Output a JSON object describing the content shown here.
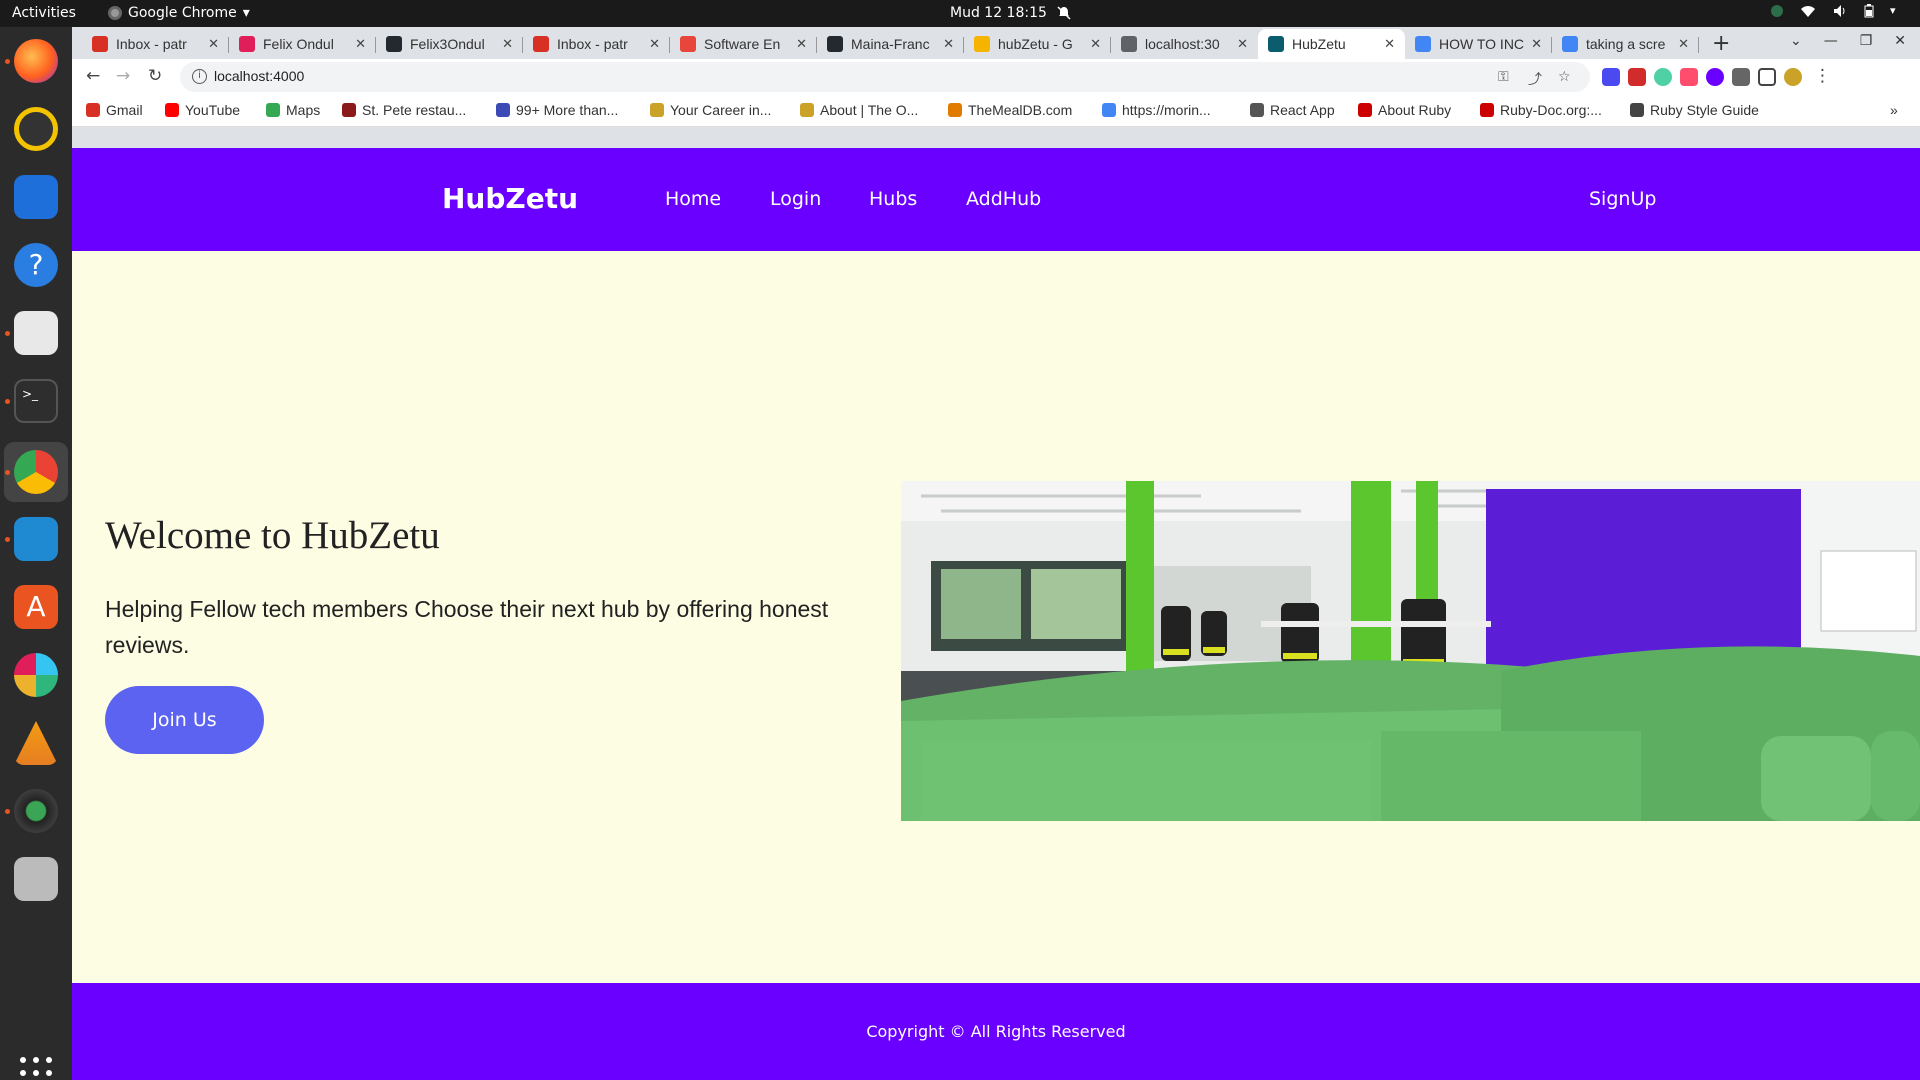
{
  "system": {
    "activities": "Activities",
    "app_name": "Google Chrome",
    "clock": "Mud 12  18:15"
  },
  "browser": {
    "tabs": [
      {
        "title": "Inbox - patr",
        "color": "#d93025"
      },
      {
        "title": "Felix Ondul",
        "color": "#e01e5a"
      },
      {
        "title": "Felix3Ondul",
        "color": "#24292f"
      },
      {
        "title": "Inbox - patr",
        "color": "#d93025"
      },
      {
        "title": "Software En",
        "color": "#e8453c"
      },
      {
        "title": "Maina-Franc",
        "color": "#24292f"
      },
      {
        "title": "hubZetu - G",
        "color": "#f4b400"
      },
      {
        "title": "localhost:30",
        "color": "#5f6368"
      },
      {
        "title": "HubZetu",
        "color": "#0b5d6e"
      },
      {
        "title": "HOW TO INC",
        "color": "#4285f4"
      },
      {
        "title": "taking a scre",
        "color": "#4285f4"
      }
    ],
    "active_tab_index": 8,
    "new_tab": "+",
    "url": "localhost:4000",
    "bookmarks": [
      {
        "label": "Gmail",
        "color": "#d93025"
      },
      {
        "label": "YouTube",
        "color": "#ff0000"
      },
      {
        "label": "Maps",
        "color": "#34a853"
      },
      {
        "label": "St. Pete restau...",
        "color": "#8b1a1a"
      },
      {
        "label": "99+ More than...",
        "color": "#3c4ab5"
      },
      {
        "label": "Your Career in...",
        "color": "#c9a227"
      },
      {
        "label": "About | The O...",
        "color": "#c9a227"
      },
      {
        "label": "TheMealDB.com",
        "color": "#e07b00"
      },
      {
        "label": "https://morin...",
        "color": "#4285f4"
      },
      {
        "label": "React App",
        "color": "#555555"
      },
      {
        "label": "About Ruby",
        "color": "#cc0000"
      },
      {
        "label": "Ruby-Doc.org:...",
        "color": "#cc0000"
      },
      {
        "label": "Ruby Style Guide",
        "color": "#444444"
      }
    ],
    "bookmarks_overflow": "»"
  },
  "page": {
    "brand": "HubZetu",
    "nav": [
      "Home",
      "Login",
      "Hubs",
      "AddHub"
    ],
    "signup": "SignUp",
    "hero": {
      "title": "Welcome to HubZetu",
      "text": "Helping Fellow tech members Choose their next hub by offering honest reviews.",
      "button": "Join Us"
    },
    "footer": "Copyright © All Rights Reserved"
  },
  "colors": {
    "brand_purple": "#6a00ff",
    "button_blue": "#5b63f0",
    "page_bg": "#fdfde4"
  }
}
